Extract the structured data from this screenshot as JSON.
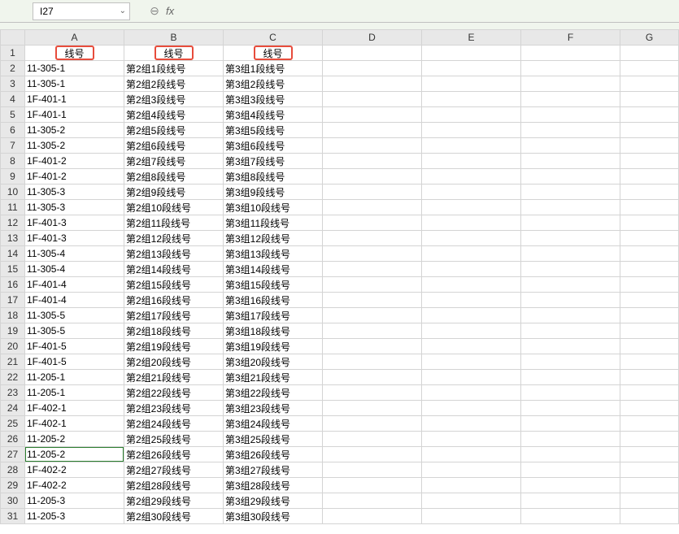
{
  "formula_bar": {
    "name_box": "I27",
    "fx_label": "fx",
    "formula_value": ""
  },
  "columns": [
    "A",
    "B",
    "C",
    "D",
    "E",
    "F",
    "G"
  ],
  "headers": {
    "a": "线号",
    "b": "线号",
    "c": "线号"
  },
  "active_row": 27,
  "rows": [
    {
      "n": 1,
      "a": "线号",
      "b": "线号",
      "c": "线号",
      "is_header": true
    },
    {
      "n": 2,
      "a": "11-305-1",
      "b": "第2组1段线号",
      "c": "第3组1段线号"
    },
    {
      "n": 3,
      "a": "11-305-1",
      "b": "第2组2段线号",
      "c": "第3组2段线号"
    },
    {
      "n": 4,
      "a": "1F-401-1",
      "b": "第2组3段线号",
      "c": "第3组3段线号"
    },
    {
      "n": 5,
      "a": "1F-401-1",
      "b": "第2组4段线号",
      "c": "第3组4段线号"
    },
    {
      "n": 6,
      "a": "11-305-2",
      "b": "第2组5段线号",
      "c": "第3组5段线号"
    },
    {
      "n": 7,
      "a": "11-305-2",
      "b": "第2组6段线号",
      "c": "第3组6段线号"
    },
    {
      "n": 8,
      "a": "1F-401-2",
      "b": "第2组7段线号",
      "c": "第3组7段线号"
    },
    {
      "n": 9,
      "a": "1F-401-2",
      "b": "第2组8段线号",
      "c": "第3组8段线号"
    },
    {
      "n": 10,
      "a": "11-305-3",
      "b": "第2组9段线号",
      "c": "第3组9段线号"
    },
    {
      "n": 11,
      "a": "11-305-3",
      "b": "第2组10段线号",
      "c": "第3组10段线号"
    },
    {
      "n": 12,
      "a": "1F-401-3",
      "b": "第2组11段线号",
      "c": "第3组11段线号"
    },
    {
      "n": 13,
      "a": "1F-401-3",
      "b": "第2组12段线号",
      "c": "第3组12段线号"
    },
    {
      "n": 14,
      "a": "11-305-4",
      "b": "第2组13段线号",
      "c": "第3组13段线号"
    },
    {
      "n": 15,
      "a": "11-305-4",
      "b": "第2组14段线号",
      "c": "第3组14段线号"
    },
    {
      "n": 16,
      "a": "1F-401-4",
      "b": "第2组15段线号",
      "c": "第3组15段线号"
    },
    {
      "n": 17,
      "a": "1F-401-4",
      "b": "第2组16段线号",
      "c": "第3组16段线号"
    },
    {
      "n": 18,
      "a": "11-305-5",
      "b": "第2组17段线号",
      "c": "第3组17段线号"
    },
    {
      "n": 19,
      "a": "11-305-5",
      "b": "第2组18段线号",
      "c": "第3组18段线号"
    },
    {
      "n": 20,
      "a": "1F-401-5",
      "b": "第2组19段线号",
      "c": "第3组19段线号"
    },
    {
      "n": 21,
      "a": "1F-401-5",
      "b": "第2组20段线号",
      "c": "第3组20段线号"
    },
    {
      "n": 22,
      "a": "11-205-1",
      "b": "第2组21段线号",
      "c": "第3组21段线号"
    },
    {
      "n": 23,
      "a": "11-205-1",
      "b": "第2组22段线号",
      "c": "第3组22段线号"
    },
    {
      "n": 24,
      "a": "1F-402-1",
      "b": "第2组23段线号",
      "c": "第3组23段线号"
    },
    {
      "n": 25,
      "a": "1F-402-1",
      "b": "第2组24段线号",
      "c": "第3组24段线号"
    },
    {
      "n": 26,
      "a": "11-205-2",
      "b": "第2组25段线号",
      "c": "第3组25段线号"
    },
    {
      "n": 27,
      "a": "11-205-2",
      "b": "第2组26段线号",
      "c": "第3组26段线号"
    },
    {
      "n": 28,
      "a": "1F-402-2",
      "b": "第2组27段线号",
      "c": "第3组27段线号"
    },
    {
      "n": 29,
      "a": "1F-402-2",
      "b": "第2组28段线号",
      "c": "第3组28段线号"
    },
    {
      "n": 30,
      "a": "11-205-3",
      "b": "第2组29段线号",
      "c": "第3组29段线号"
    },
    {
      "n": 31,
      "a": "11-205-3",
      "b": "第2组30段线号",
      "c": "第3组30段线号"
    }
  ]
}
